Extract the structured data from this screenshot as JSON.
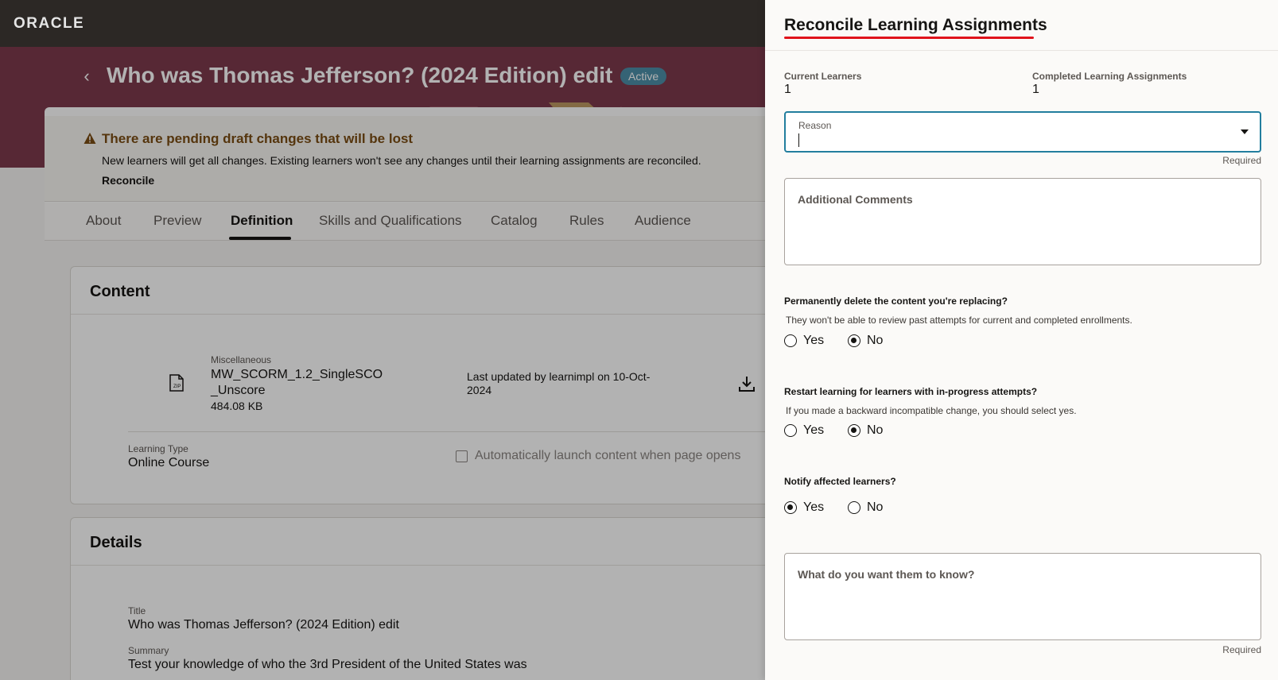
{
  "topbar": {
    "logo": "ORACLE"
  },
  "header": {
    "title": "Who was Thomas Jefferson? (2024 Edition) edit",
    "status": "Active"
  },
  "warning": {
    "title": "There are pending draft changes that will be lost",
    "body": "New learners will get all changes. Existing learners won't see any changes until their learning assignments are reconciled.",
    "link": "Reconcile"
  },
  "tabs": [
    "About",
    "Preview",
    "Definition",
    "Skills and Qualifications",
    "Catalog",
    "Rules",
    "Audience"
  ],
  "active_tab": "Definition",
  "content": {
    "title": "Content",
    "file": {
      "category": "Miscellaneous",
      "name": "MW_SCORM_1.2_SingleSCO _Unscore",
      "size": "484.08 KB",
      "updated": "Last updated by learnimpl on 10-Oct-2024"
    },
    "learning_type_label": "Learning Type",
    "learning_type_value": "Online Course",
    "auto_launch_label": "Automatically launch content when page opens"
  },
  "details": {
    "title": "Details",
    "title_label": "Title",
    "title_value": "Who was Thomas Jefferson? (2024 Edition) edit",
    "summary_label": "Summary",
    "summary_value": "Test your knowledge of who the 3rd President of the United States was"
  },
  "drawer": {
    "title": "Reconcile Learning Assignments",
    "current_learners_label": "Current Learners",
    "current_learners_value": "1",
    "completed_label": "Completed Learning Assignments",
    "completed_value": "1",
    "reason_label": "Reason",
    "reason_value": "",
    "required": "Required",
    "comments_placeholder": "Additional Comments",
    "q1": {
      "label": "Permanently delete the content you're replacing?",
      "help": "They won't be able to review past attempts for current and completed enrollments.",
      "yes": "Yes",
      "no": "No",
      "selected": "No"
    },
    "q2": {
      "label": "Restart learning for learners with in-progress attempts?",
      "help": "If you made a backward incompatible change, you should select yes.",
      "yes": "Yes",
      "no": "No",
      "selected": "No"
    },
    "q3": {
      "label": "Notify affected learners?",
      "yes": "Yes",
      "no": "No",
      "selected": "Yes"
    },
    "message_placeholder": "What do you want them to know?"
  },
  "colors": {
    "topbar": "#312d2a",
    "hero": "#7d3a4d",
    "badge": "#4d8ea8",
    "focus_border": "#227e9e",
    "title_underline": "#e0131b",
    "warning_text": "#7a4d14"
  }
}
